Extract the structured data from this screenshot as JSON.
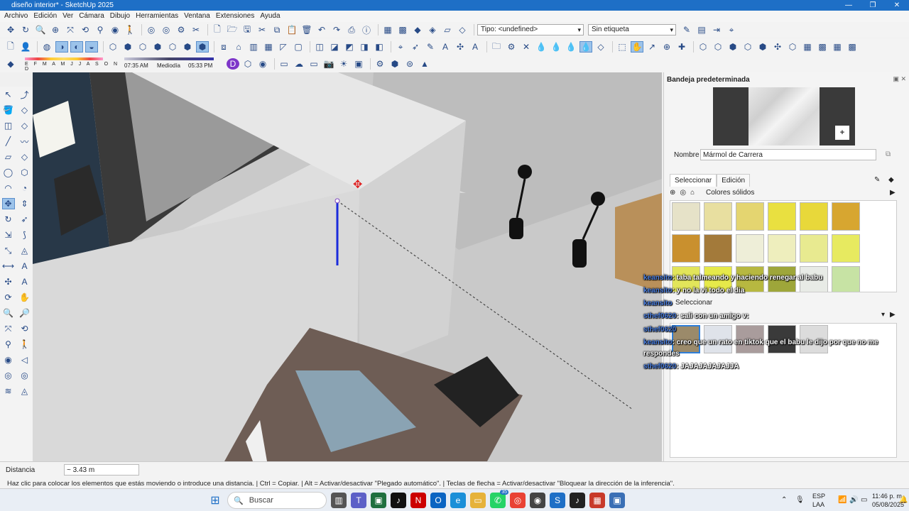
{
  "window": {
    "title": "diseño interior* - SketchUp 2025",
    "controls": [
      "—",
      "❐",
      "✕"
    ]
  },
  "menu": [
    "Archivo",
    "Edición",
    "Ver",
    "Cámara",
    "Dibujo",
    "Herramientas",
    "Ventana",
    "Extensiones",
    "Ayuda"
  ],
  "toolbar": {
    "tag_type": "Tipo: <undefined>",
    "tag_label": "Sin etiqueta"
  },
  "shadows": {
    "months": "E F M A M J J A S O N D",
    "time_start": "07:35 AM",
    "time_mid": "Mediodía",
    "time_end": "05:33 PM"
  },
  "tray": {
    "title": "Bandeja predeterminada",
    "name_label": "Nombre",
    "name_value": "Mármol de Carrera",
    "tab_select": "Seleccionar",
    "tab_edit": "Edición",
    "collection": "Colores sólidos",
    "section2_label": "Seleccionar",
    "swatch_colors": [
      "#e6e2c8",
      "#e8dfa0",
      "#e4d570",
      "#e9e040",
      "#e8d83a",
      "#d7a630",
      "#c9902e",
      "#a37a3a",
      "#eeeed8",
      "#eeeebd",
      "#e8ea90",
      "#e7ea60",
      "#e2e55a",
      "#e6e94a",
      "#b7b840",
      "#9ea63a",
      "#e8ebe6",
      "#c7e3a4"
    ],
    "swatch_colors2": [
      "#9b8a6a",
      "#dfe3ea",
      "#a99c9c",
      "#3a3a3a",
      "#dcdcdc"
    ]
  },
  "chat": [
    {
      "user": "keansito",
      "text": ": taba talmeando y haciendo renegar al babu"
    },
    {
      "user": "keansito",
      "text": ": y no la vi todo el dia"
    },
    {
      "user": "keansito",
      "text": ""
    },
    {
      "user": "sthef0620",
      "text": ": sali con un amigo v:"
    },
    {
      "user": "sthef0620",
      "text": ""
    },
    {
      "user": "keansito",
      "text": ": creo que un rato en tiktok que el babu le dijo por que no me"
    },
    {
      "user": "",
      "text": "respondes"
    },
    {
      "user": "sthef0620",
      "text": ": JAJAJAJAJAJJA"
    }
  ],
  "status": {
    "measure_label": "Distancia",
    "measure_value": "~ 3.43 m",
    "hint": "Haz clic para colocar los elementos que estás moviendo o introduce una distancia. | Ctrl = Copiar. | Alt = Activar/desactivar \"Plegado automático\". | Teclas de flecha = Activar/desactivar \"Bloquear la dirección de la inferencia\"."
  },
  "taskbar": {
    "search": "Buscar",
    "lang1": "ESP",
    "lang2": "LAA",
    "time": "11:46 p. m.",
    "date": "05/08/2025",
    "badge": "35"
  },
  "colors": {
    "accent": "#1e6fc6",
    "axis_blue": "#1a2cdc",
    "move_red": "#e02020"
  }
}
